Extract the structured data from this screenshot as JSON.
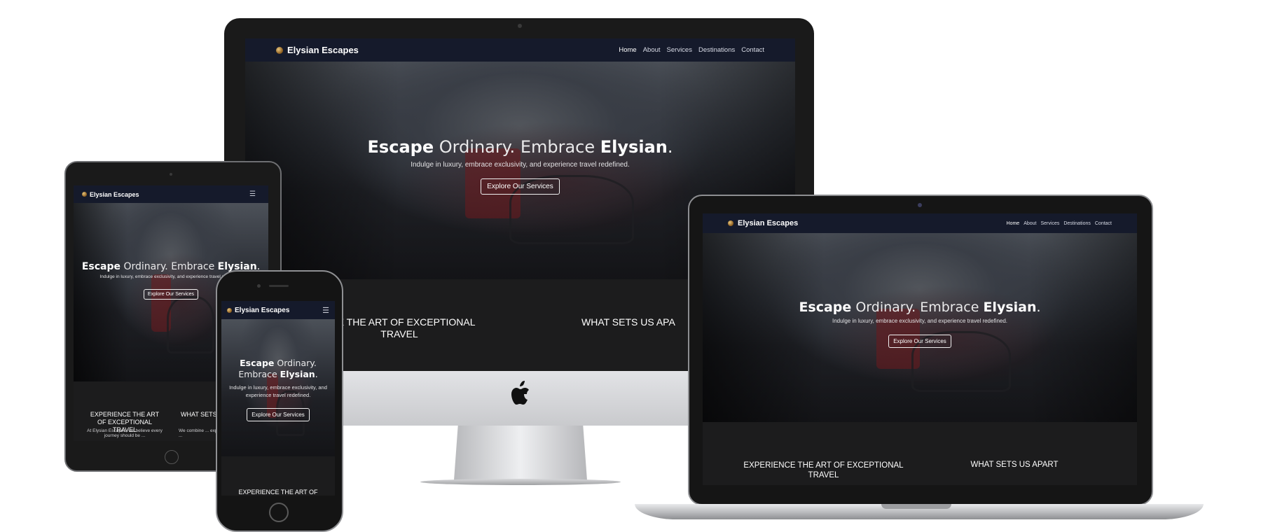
{
  "site": {
    "brand": "Elysian Escapes",
    "nav": [
      "Home",
      "About",
      "Services",
      "Destinations",
      "Contact"
    ],
    "active_nav": "Home",
    "hero_title": {
      "w1": "Escape",
      "w2": "Ordinary.",
      "w3": "Embrace",
      "w4": "Elysian",
      "w5": "."
    },
    "hero_subtitle": "Indulge in luxury, embrace exclusivity, and experience travel redefined.",
    "hero_button": "Explore Our Services",
    "section_left_heading": "Experience the Art of Exceptional Travel",
    "section_right_heading": "What Sets Us Apart",
    "ipad_section_right_heading": "What Sets",
    "ipad_section_left_text": "At Elysian Escapes, we believe every journey should be ...",
    "ipad_section_right_text": "We combine ... expertise, a ...",
    "imac_section_left_heading": "NCE THE ART OF EXCEPTIONAL TRAVEL",
    "imac_section_right_heading": "WHAT SETS US APA",
    "iphone_section_heading": "EXPERIENCE THE ART OF"
  },
  "colors": {
    "nav_bg": "#151a2b",
    "section_bg": "#1c1c1d",
    "text": "#ffffff"
  },
  "icons": [
    "apple-logo-icon",
    "menu-icon",
    "brand-logo-icon"
  ]
}
